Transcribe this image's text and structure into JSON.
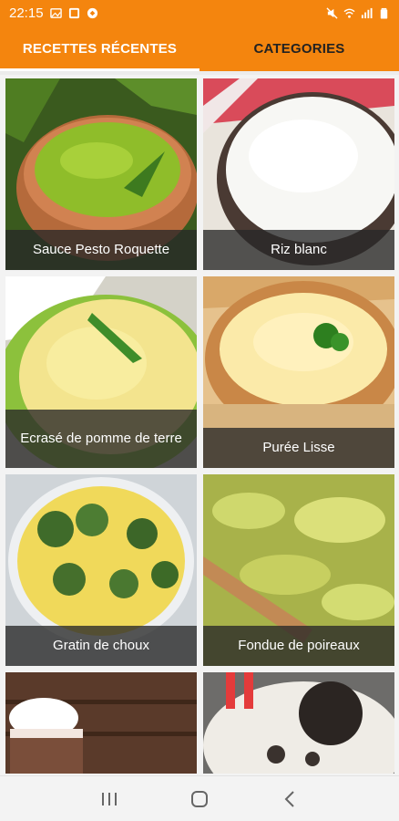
{
  "status_bar": {
    "time": "22:15",
    "icons": [
      "image-icon",
      "gallery-icon",
      "app-icon",
      "mute-icon",
      "wifi-icon",
      "signal-icon",
      "battery-icon"
    ]
  },
  "tabs": [
    {
      "label": "RECETTES RÉCENTES",
      "active": true
    },
    {
      "label": "CATEGORIES",
      "active": false
    }
  ],
  "recipes": [
    {
      "title": "Sauce Pesto Roquette"
    },
    {
      "title": "Riz blanc"
    },
    {
      "title": "Ecrasé de pomme de terre"
    },
    {
      "title": "Purée Lisse"
    },
    {
      "title": "Gratin de choux"
    },
    {
      "title": "Fondue de poireaux"
    }
  ],
  "colors": {
    "accent": "#f4850e",
    "caption_bg": "#282828"
  },
  "nav": {
    "buttons": [
      "recents-icon",
      "home-icon",
      "back-icon"
    ]
  }
}
